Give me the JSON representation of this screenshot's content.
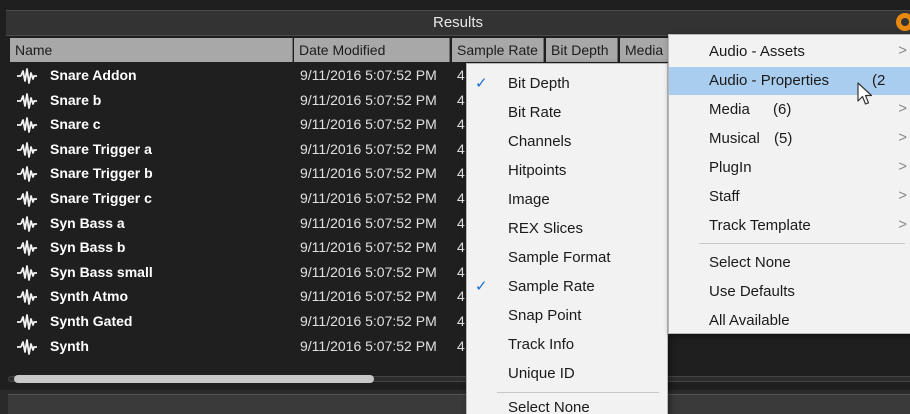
{
  "panel": {
    "title": "Results"
  },
  "columns": [
    "Name",
    "Date Modified",
    "Sample Rate",
    "Bit Depth",
    "Media"
  ],
  "rows": [
    {
      "name": "Snare Addon",
      "date": "9/11/2016 5:07:52 PM",
      "rate": "4"
    },
    {
      "name": "Snare b",
      "date": "9/11/2016 5:07:52 PM",
      "rate": "4"
    },
    {
      "name": "Snare c",
      "date": "9/11/2016 5:07:52 PM",
      "rate": "4"
    },
    {
      "name": "Snare Trigger a",
      "date": "9/11/2016 5:07:52 PM",
      "rate": "4"
    },
    {
      "name": "Snare Trigger b",
      "date": "9/11/2016 5:07:52 PM",
      "rate": "4"
    },
    {
      "name": "Snare Trigger c",
      "date": "9/11/2016 5:07:52 PM",
      "rate": "4"
    },
    {
      "name": "Syn Bass a",
      "date": "9/11/2016 5:07:52 PM",
      "rate": "4"
    },
    {
      "name": "Syn Bass b",
      "date": "9/11/2016 5:07:52 PM",
      "rate": "4"
    },
    {
      "name": "Syn Bass small",
      "date": "9/11/2016 5:07:52 PM",
      "rate": "4"
    },
    {
      "name": "Synth Atmo",
      "date": "9/11/2016 5:07:52 PM",
      "rate": "4"
    },
    {
      "name": "Synth Gated",
      "date": "9/11/2016 5:07:52 PM",
      "rate": "4"
    },
    {
      "name": "Synth",
      "date": "9/11/2016 5:07:52 PM",
      "rate": "4"
    }
  ],
  "property_menu": {
    "items": [
      {
        "label": "Bit Depth",
        "checked": true
      },
      {
        "label": "Bit Rate",
        "checked": false
      },
      {
        "label": "Channels",
        "checked": false
      },
      {
        "label": "Hitpoints",
        "checked": false
      },
      {
        "label": "Image",
        "checked": false
      },
      {
        "label": "REX Slices",
        "checked": false
      },
      {
        "label": "Sample Format",
        "checked": false
      },
      {
        "label": "Sample Rate",
        "checked": true
      },
      {
        "label": "Snap Point",
        "checked": false
      },
      {
        "label": "Track Info",
        "checked": false
      },
      {
        "label": "Unique ID",
        "checked": false
      }
    ],
    "select_none": "Select None"
  },
  "category_menu": {
    "items": [
      {
        "label": "Audio - Assets",
        "count": "",
        "arrow": ">"
      },
      {
        "label": "Audio - Properties",
        "count": "(2",
        "arrow": ""
      },
      {
        "label": "Media",
        "count": "(6)",
        "arrow": ">"
      },
      {
        "label": "Musical",
        "count": "(5)",
        "arrow": ">"
      },
      {
        "label": "PlugIn",
        "count": "",
        "arrow": ">"
      },
      {
        "label": "Staff",
        "count": "",
        "arrow": ">"
      },
      {
        "label": "Track Template",
        "count": "",
        "arrow": ">"
      }
    ],
    "actions": [
      "Select None",
      "Use Defaults",
      "All Available"
    ]
  },
  "colors": {
    "highlight": "#a9cdef",
    "check": "#1a6fd0",
    "gear": "#e98a10"
  },
  "icons": {
    "row_icon": "waveform-icon",
    "gear": "gear-icon",
    "check": "checkmark-icon",
    "submenu": "chevron-right-icon",
    "cursor": "mouse-pointer-icon"
  }
}
